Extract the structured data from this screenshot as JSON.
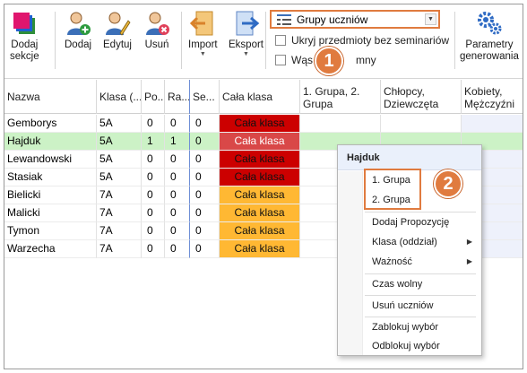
{
  "toolbar": {
    "add_section": "Dodaj\nsekcje",
    "add_section_l1": "Dodaj",
    "add_section_l2": "sekcje",
    "add": "Dodaj",
    "edit": "Edytuj",
    "delete": "Usuń",
    "import": "Import",
    "export": "Eksport",
    "combo_value": "Grupy uczniów",
    "checkbox1": "Ukryj przedmioty bez seminariów",
    "checkbox2_a": "Wąs",
    "checkbox2_b": "mny",
    "params_l1": "Parametry",
    "params_l2": "generowania"
  },
  "badges": {
    "one": "1",
    "two": "2"
  },
  "grid": {
    "headers": [
      {
        "l1": "Nazwa",
        "l2": ""
      },
      {
        "l1": "Klasa (...",
        "l2": ""
      },
      {
        "l1": "Po...",
        "l2": ""
      },
      {
        "l1": "Ra...",
        "l2": ""
      },
      {
        "l1": "Se...",
        "l2": ""
      },
      {
        "l1": "Cała klasa",
        "l2": ""
      },
      {
        "l1": "1. Grupa, 2.",
        "l2": "Grupa"
      },
      {
        "l1": "Chłopcy,",
        "l2": "Dziewczęta"
      },
      {
        "l1": "Kobiety,",
        "l2": "Mężczyźni"
      }
    ],
    "rows": [
      {
        "name": "Gemborys",
        "klasa": "5A",
        "po": "0",
        "ra": "0",
        "se": "0",
        "cala": "Cała klasa",
        "cala_color": "#cc0000",
        "selected": false
      },
      {
        "name": "Hajduk",
        "klasa": "5A",
        "po": "1",
        "ra": "1",
        "se": "0",
        "cala": "Cała klasa",
        "cala_color": "#d94848",
        "selected": true
      },
      {
        "name": "Lewandowski",
        "klasa": "5A",
        "po": "0",
        "ra": "0",
        "se": "0",
        "cala": "Cała klasa",
        "cala_color": "#cc0000",
        "selected": false
      },
      {
        "name": "Stasiak",
        "klasa": "5A",
        "po": "0",
        "ra": "0",
        "se": "0",
        "cala": "Cała klasa",
        "cala_color": "#cc0000",
        "selected": false
      },
      {
        "name": "Bielicki",
        "klasa": "7A",
        "po": "0",
        "ra": "0",
        "se": "0",
        "cala": "Cała klasa",
        "cala_color": "#ffb833",
        "selected": false
      },
      {
        "name": "Malicki",
        "klasa": "7A",
        "po": "0",
        "ra": "0",
        "se": "0",
        "cala": "Cała klasa",
        "cala_color": "#ffb833",
        "selected": false
      },
      {
        "name": "Tymon",
        "klasa": "7A",
        "po": "0",
        "ra": "0",
        "se": "0",
        "cala": "Cała klasa",
        "cala_color": "#ffb833",
        "selected": false
      },
      {
        "name": "Warzecha",
        "klasa": "7A",
        "po": "0",
        "ra": "0",
        "se": "0",
        "cala": "Cała klasa",
        "cala_color": "#ffb833",
        "selected": false
      }
    ]
  },
  "context_menu": {
    "title": "Hajduk",
    "group1": "1. Grupa",
    "group2": "2. Grupa",
    "add_proposal": "Dodaj Propozycję",
    "class": "Klasa (oddział)",
    "importance": "Ważność",
    "free_time": "Czas wolny",
    "remove_students": "Usuń uczniów",
    "lock": "Zablokuj wybór",
    "unlock": "Odblokuj wybór"
  },
  "colors": {
    "accent": "#e07b3f",
    "selected_row": "#ccf2c6",
    "red": "#cc0000",
    "orange": "#ffb833"
  }
}
